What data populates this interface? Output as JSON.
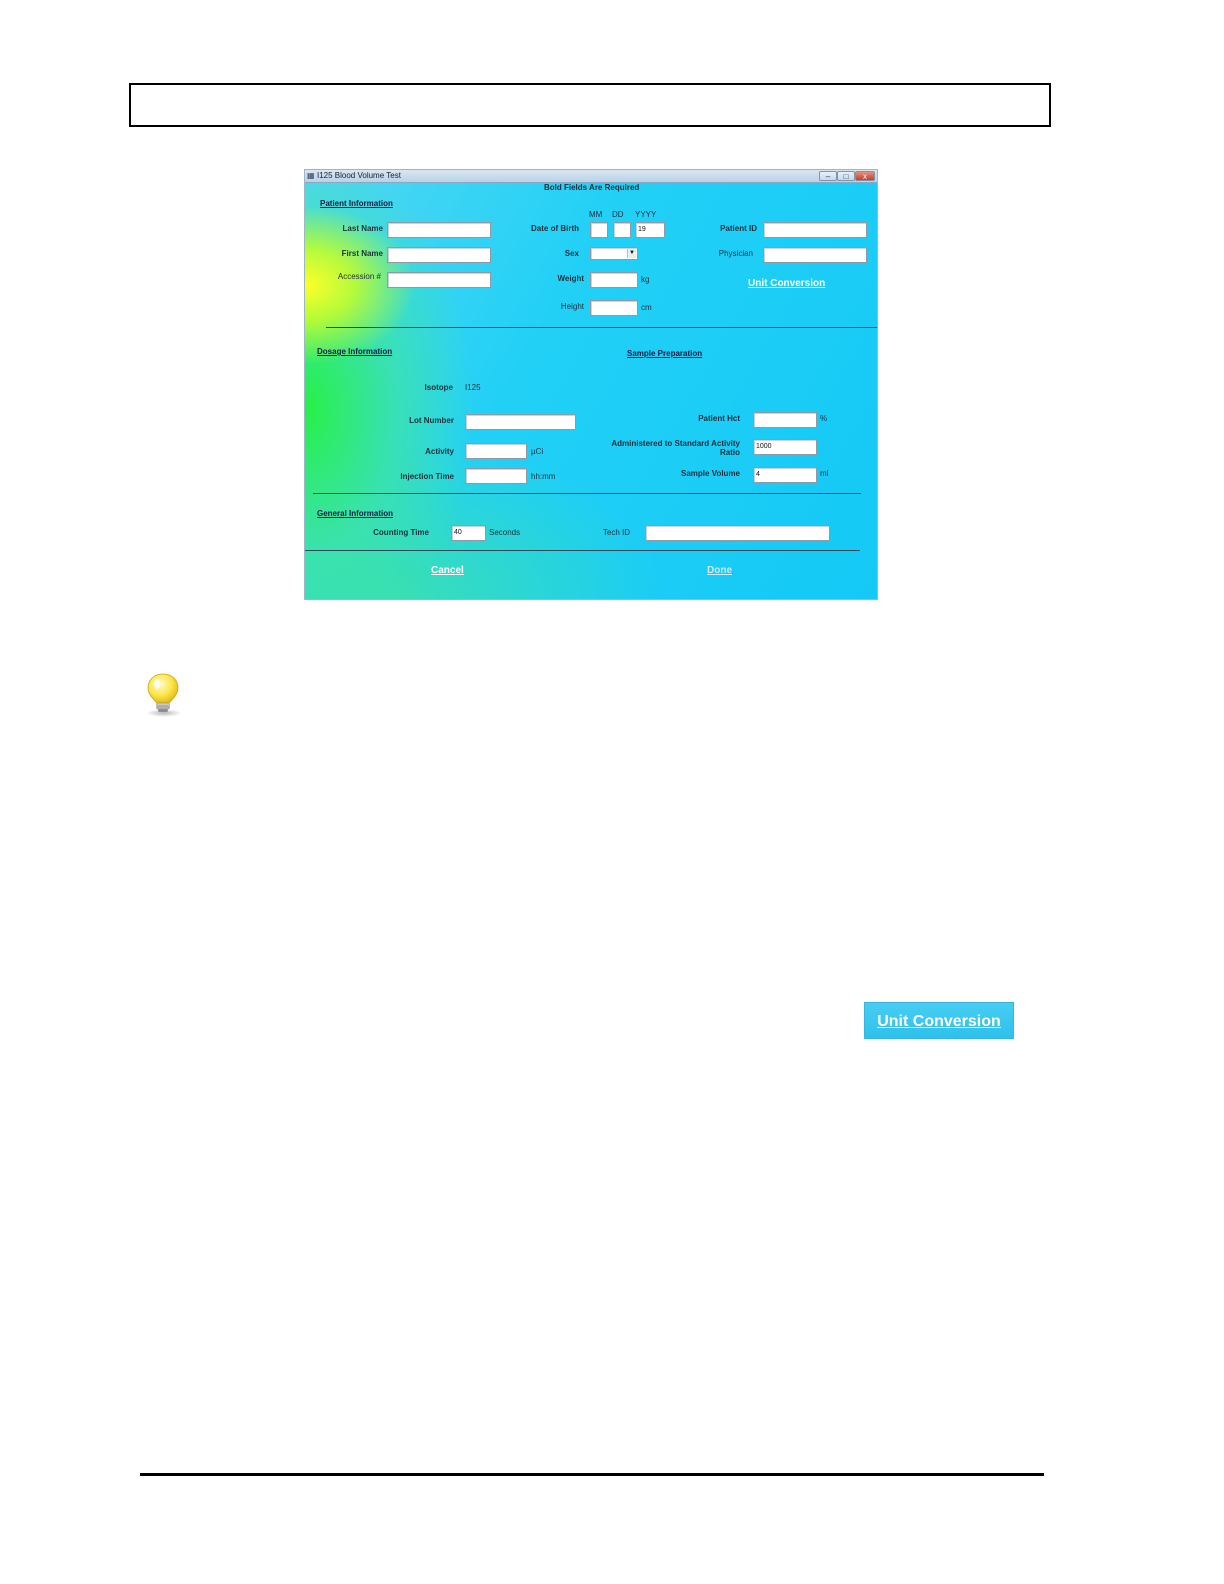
{
  "window": {
    "title": "I125 Blood Volume Test",
    "required_note": "Bold Fields Are Required",
    "controls": {
      "minimize": "–",
      "maximize": "□",
      "close": "x"
    }
  },
  "patient": {
    "section_label": "Patient Information",
    "last_name_label": "Last Name",
    "first_name_label": "First Name",
    "accession_label": "Accession #",
    "dob_label": "Date of Birth",
    "dob_mm_label": "MM",
    "dob_dd_label": "DD",
    "dob_yyyy_label": "YYYY",
    "dob_yyyy_value": "19",
    "sex_label": "Sex",
    "weight_label": "Weight",
    "weight_unit": "kg",
    "height_label": "Height",
    "height_unit": "cm",
    "patient_id_label": "Patient ID",
    "physician_label": "Physician",
    "unit_conversion_label": "Unit Conversion"
  },
  "dosage": {
    "section_label": "Dosage Information",
    "isotope_label": "Isotope",
    "isotope_value": "I125",
    "lot_number_label": "Lot Number",
    "activity_label": "Activity",
    "activity_unit": "µCi",
    "injection_time_label": "Injection Time",
    "injection_time_unit": "hh:mm"
  },
  "sample": {
    "section_label": "Sample Preparation",
    "hct_label": "Patient Hct",
    "hct_unit": "%",
    "ratio_label_line1": "Administered to Standard Activity",
    "ratio_label_line2": "Ratio",
    "ratio_value": "1000",
    "volume_label": "Sample Volume",
    "volume_value": "4",
    "volume_unit": "ml"
  },
  "general": {
    "section_label": "General Information",
    "counting_time_label": "Counting Time",
    "counting_time_value": "40",
    "counting_time_unit": "Seconds",
    "tech_id_label": "Tech ID"
  },
  "actions": {
    "cancel_label": "Cancel",
    "done_label": "Done"
  },
  "callout": {
    "unit_conversion_label": "Unit Conversion",
    "icon": "lightbulb-icon"
  }
}
